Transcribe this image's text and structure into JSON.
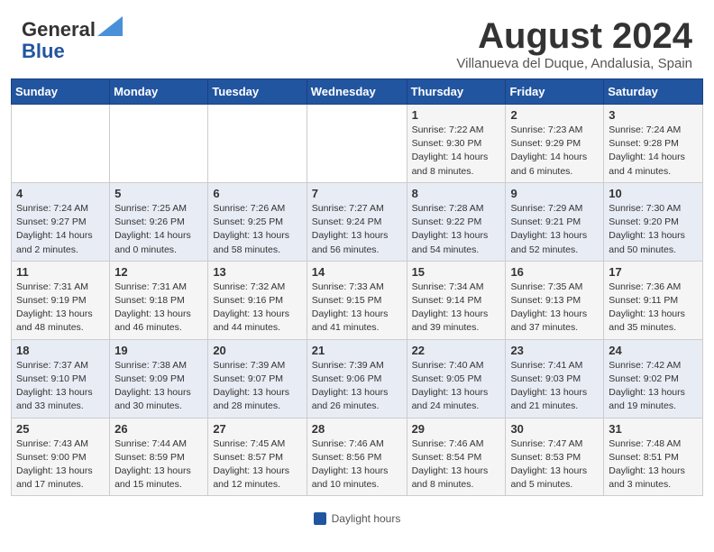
{
  "header": {
    "logo_general": "General",
    "logo_blue": "Blue",
    "month_title": "August 2024",
    "subtitle": "Villanueva del Duque, Andalusia, Spain"
  },
  "days_of_week": [
    "Sunday",
    "Monday",
    "Tuesday",
    "Wednesday",
    "Thursday",
    "Friday",
    "Saturday"
  ],
  "weeks": [
    [
      {
        "num": "",
        "info": ""
      },
      {
        "num": "",
        "info": ""
      },
      {
        "num": "",
        "info": ""
      },
      {
        "num": "",
        "info": ""
      },
      {
        "num": "1",
        "info": "Sunrise: 7:22 AM\nSunset: 9:30 PM\nDaylight: 14 hours\nand 8 minutes."
      },
      {
        "num": "2",
        "info": "Sunrise: 7:23 AM\nSunset: 9:29 PM\nDaylight: 14 hours\nand 6 minutes."
      },
      {
        "num": "3",
        "info": "Sunrise: 7:24 AM\nSunset: 9:28 PM\nDaylight: 14 hours\nand 4 minutes."
      }
    ],
    [
      {
        "num": "4",
        "info": "Sunrise: 7:24 AM\nSunset: 9:27 PM\nDaylight: 14 hours\nand 2 minutes."
      },
      {
        "num": "5",
        "info": "Sunrise: 7:25 AM\nSunset: 9:26 PM\nDaylight: 14 hours\nand 0 minutes."
      },
      {
        "num": "6",
        "info": "Sunrise: 7:26 AM\nSunset: 9:25 PM\nDaylight: 13 hours\nand 58 minutes."
      },
      {
        "num": "7",
        "info": "Sunrise: 7:27 AM\nSunset: 9:24 PM\nDaylight: 13 hours\nand 56 minutes."
      },
      {
        "num": "8",
        "info": "Sunrise: 7:28 AM\nSunset: 9:22 PM\nDaylight: 13 hours\nand 54 minutes."
      },
      {
        "num": "9",
        "info": "Sunrise: 7:29 AM\nSunset: 9:21 PM\nDaylight: 13 hours\nand 52 minutes."
      },
      {
        "num": "10",
        "info": "Sunrise: 7:30 AM\nSunset: 9:20 PM\nDaylight: 13 hours\nand 50 minutes."
      }
    ],
    [
      {
        "num": "11",
        "info": "Sunrise: 7:31 AM\nSunset: 9:19 PM\nDaylight: 13 hours\nand 48 minutes."
      },
      {
        "num": "12",
        "info": "Sunrise: 7:31 AM\nSunset: 9:18 PM\nDaylight: 13 hours\nand 46 minutes."
      },
      {
        "num": "13",
        "info": "Sunrise: 7:32 AM\nSunset: 9:16 PM\nDaylight: 13 hours\nand 44 minutes."
      },
      {
        "num": "14",
        "info": "Sunrise: 7:33 AM\nSunset: 9:15 PM\nDaylight: 13 hours\nand 41 minutes."
      },
      {
        "num": "15",
        "info": "Sunrise: 7:34 AM\nSunset: 9:14 PM\nDaylight: 13 hours\nand 39 minutes."
      },
      {
        "num": "16",
        "info": "Sunrise: 7:35 AM\nSunset: 9:13 PM\nDaylight: 13 hours\nand 37 minutes."
      },
      {
        "num": "17",
        "info": "Sunrise: 7:36 AM\nSunset: 9:11 PM\nDaylight: 13 hours\nand 35 minutes."
      }
    ],
    [
      {
        "num": "18",
        "info": "Sunrise: 7:37 AM\nSunset: 9:10 PM\nDaylight: 13 hours\nand 33 minutes."
      },
      {
        "num": "19",
        "info": "Sunrise: 7:38 AM\nSunset: 9:09 PM\nDaylight: 13 hours\nand 30 minutes."
      },
      {
        "num": "20",
        "info": "Sunrise: 7:39 AM\nSunset: 9:07 PM\nDaylight: 13 hours\nand 28 minutes."
      },
      {
        "num": "21",
        "info": "Sunrise: 7:39 AM\nSunset: 9:06 PM\nDaylight: 13 hours\nand 26 minutes."
      },
      {
        "num": "22",
        "info": "Sunrise: 7:40 AM\nSunset: 9:05 PM\nDaylight: 13 hours\nand 24 minutes."
      },
      {
        "num": "23",
        "info": "Sunrise: 7:41 AM\nSunset: 9:03 PM\nDaylight: 13 hours\nand 21 minutes."
      },
      {
        "num": "24",
        "info": "Sunrise: 7:42 AM\nSunset: 9:02 PM\nDaylight: 13 hours\nand 19 minutes."
      }
    ],
    [
      {
        "num": "25",
        "info": "Sunrise: 7:43 AM\nSunset: 9:00 PM\nDaylight: 13 hours\nand 17 minutes."
      },
      {
        "num": "26",
        "info": "Sunrise: 7:44 AM\nSunset: 8:59 PM\nDaylight: 13 hours\nand 15 minutes."
      },
      {
        "num": "27",
        "info": "Sunrise: 7:45 AM\nSunset: 8:57 PM\nDaylight: 13 hours\nand 12 minutes."
      },
      {
        "num": "28",
        "info": "Sunrise: 7:46 AM\nSunset: 8:56 PM\nDaylight: 13 hours\nand 10 minutes."
      },
      {
        "num": "29",
        "info": "Sunrise: 7:46 AM\nSunset: 8:54 PM\nDaylight: 13 hours\nand 8 minutes."
      },
      {
        "num": "30",
        "info": "Sunrise: 7:47 AM\nSunset: 8:53 PM\nDaylight: 13 hours\nand 5 minutes."
      },
      {
        "num": "31",
        "info": "Sunrise: 7:48 AM\nSunset: 8:51 PM\nDaylight: 13 hours\nand 3 minutes."
      }
    ]
  ],
  "footer": {
    "label": "Daylight hours"
  }
}
